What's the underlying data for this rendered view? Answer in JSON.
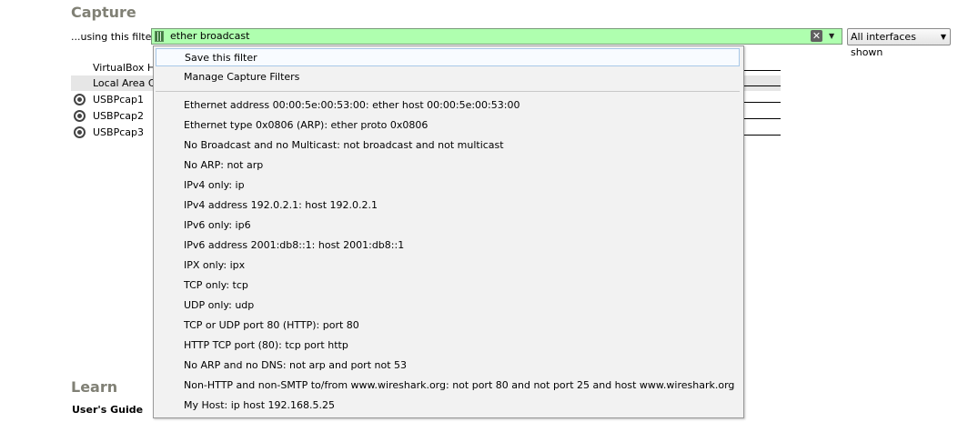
{
  "capture": {
    "title": "Capture"
  },
  "filter": {
    "label": "...using this filter:",
    "value": "ether broadcast",
    "clear_symbol": "✕",
    "dropdown_symbol": "▼"
  },
  "interfaces_select": {
    "value": "All interfaces shown",
    "arrow": "▼"
  },
  "interfaces": [
    {
      "name": "VirtualBox H"
    },
    {
      "name": "Local Area C"
    },
    {
      "name": "USBPcap1"
    },
    {
      "name": "USBPcap2"
    },
    {
      "name": "USBPcap3"
    }
  ],
  "learn": {
    "title": "Learn",
    "users_guide": "User's Guide"
  },
  "menu": {
    "actions": [
      "Save this filter",
      "Manage Capture Filters"
    ],
    "filters": [
      "Ethernet address 00:00:5e:00:53:00: ether host 00:00:5e:00:53:00",
      "Ethernet type 0x0806 (ARP): ether proto 0x0806",
      "No Broadcast and no Multicast: not broadcast and not multicast",
      "No ARP: not arp",
      "IPv4 only: ip",
      "IPv4 address 192.0.2.1: host 192.0.2.1",
      "IPv6 only: ip6",
      "IPv6 address 2001:db8::1: host 2001:db8::1",
      "IPX only: ipx",
      "TCP only: tcp",
      "UDP only: udp",
      "TCP or UDP port 80 (HTTP): port 80",
      "HTTP TCP port (80): tcp port http",
      "No ARP and no DNS: not arp and port not 53",
      "Non-HTTP and non-SMTP to/from www.wireshark.org: not port 80 and not port 25 and host www.wireshark.org",
      "My Host: ip host 192.168.5.25"
    ]
  },
  "colors": {
    "filter_valid_bg": "#afffaf",
    "section_title": "#808075",
    "menu_bg": "#f2f2f2",
    "menu_highlight_border": "#a8c8e8"
  }
}
